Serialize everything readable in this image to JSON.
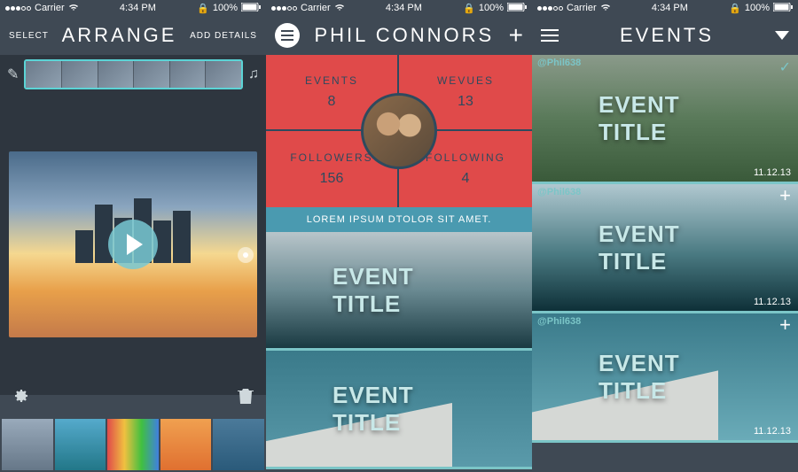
{
  "status": {
    "carrier": "Carrier",
    "time": "4:34 PM",
    "battery": "100%"
  },
  "screen1": {
    "nav": {
      "left": "SELECT",
      "title": "ARRANGE",
      "right": "ADD DETAILS"
    }
  },
  "screen2": {
    "nav": {
      "title": "PHIL CONNORS"
    },
    "stats": {
      "events": {
        "label": "EVENTS",
        "value": "8"
      },
      "wevues": {
        "label": "WEVUES",
        "value": "13"
      },
      "followers": {
        "label": "FOLLOWERS",
        "value": "156"
      },
      "following": {
        "label": "FOLLOWING",
        "value": "4"
      }
    },
    "bio": "LOREM IPSUM DTOLOR SIT AMET.",
    "events": [
      {
        "title": "EVENT TITLE"
      },
      {
        "title": "EVENT TITLE"
      }
    ]
  },
  "screen3": {
    "nav": {
      "title": "EVENTS"
    },
    "events": [
      {
        "handle": "@Phil638",
        "title": "EVENT TITLE",
        "date": "11.12.13",
        "selected": true
      },
      {
        "handle": "@Phil638",
        "title": "EVENT TITLE",
        "date": "11.12.13",
        "selected": false
      },
      {
        "handle": "@Phil638",
        "title": "EVENT TITLE",
        "date": "11.12.13",
        "selected": false
      }
    ]
  }
}
